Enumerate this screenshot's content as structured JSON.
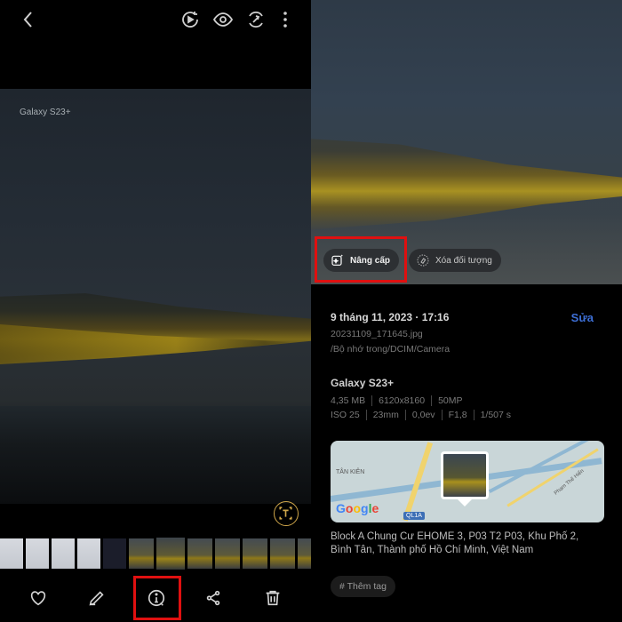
{
  "left": {
    "watermark": "Galaxy S23+",
    "topbar_icons": [
      "back-arrow-icon",
      "motion-photo-icon",
      "eye-icon",
      "remaster-icon",
      "more-vert-icon"
    ],
    "bottombar_icons": [
      "heart-icon",
      "pencil-icon",
      "info-icon",
      "share-icon",
      "trash-icon"
    ]
  },
  "right": {
    "chips": {
      "upgrade": "Nâng cấp",
      "erase": "Xóa đối tượng"
    },
    "date": "9 tháng 11, 2023 · 17:16",
    "edit": "Sửa",
    "filename": "20231109_171645.jpg",
    "path": "/Bộ nhớ trong/DCIM/Camera",
    "device": "Galaxy S23+",
    "specs_row1": [
      "4,35 MB",
      "6120x8160",
      "50MP"
    ],
    "specs_row2": [
      "ISO 25",
      "23mm",
      "0,0ev",
      "F1,8",
      "1/507 s"
    ],
    "map": {
      "place_label": "TÂN KIÊN",
      "road_label": "QL1A",
      "street_label": "Phạm Thế Hiển",
      "provider": "Google"
    },
    "address": "Block A Chung Cư EHOME 3, P03 T2 P03, Khu Phố 2, Bình Tân, Thành phố Hồ Chí Minh, Việt Nam",
    "tag_button": "# Thêm tag"
  },
  "colors": {
    "highlight": "#e01010",
    "accent_blue": "#3d6fd6",
    "text_button": "#cfa64a"
  }
}
